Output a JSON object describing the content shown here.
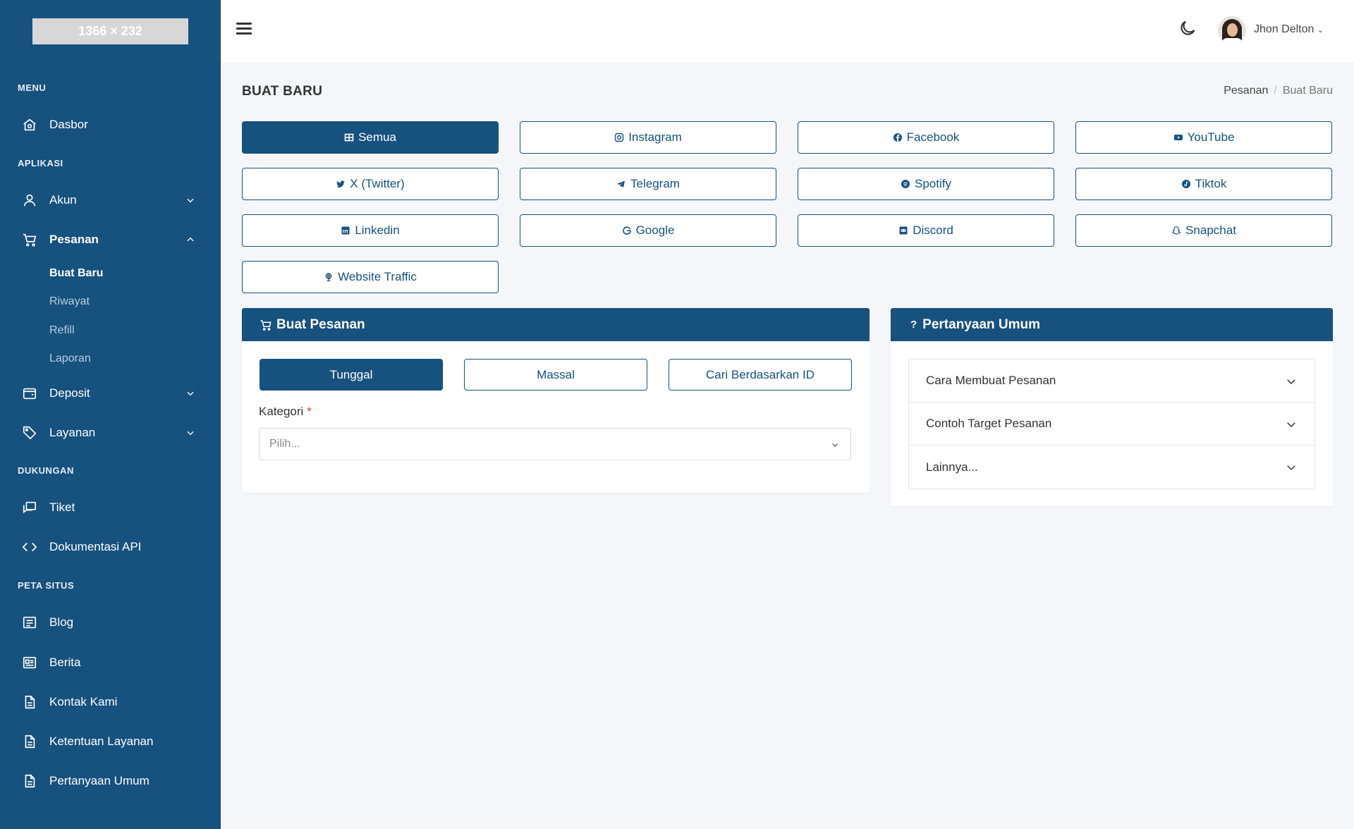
{
  "logo": {
    "text": "1366 × 232"
  },
  "sidebar": {
    "sections": {
      "menu": "MENU",
      "apps": "APLIKASI",
      "support": "DUKUNGAN",
      "sitemap": "PETA SITUS"
    },
    "items": {
      "dashboard": "Dasbor",
      "account": "Akun",
      "orders": "Pesanan",
      "deposit": "Deposit",
      "services": "Layanan",
      "ticket": "Tiket",
      "api_docs": "Dokumentasi API",
      "blog": "Blog",
      "news": "Berita",
      "contact": "Kontak Kami",
      "terms": "Ketentuan Layanan",
      "faq": "Pertanyaan Umum"
    },
    "orders_sub": {
      "new": "Buat Baru",
      "history": "Riwayat",
      "refill": "Refill",
      "report": "Laporan"
    }
  },
  "topbar": {
    "username": "Jhon Delton"
  },
  "page": {
    "title": "BUAT BARU",
    "breadcrumb": {
      "parent": "Pesanan",
      "current": "Buat Baru"
    }
  },
  "platforms": {
    "all": "Semua",
    "instagram": "Instagram",
    "facebook": "Facebook",
    "youtube": "YouTube",
    "twitter": "X (Twitter)",
    "telegram": "Telegram",
    "spotify": "Spotify",
    "tiktok": "Tiktok",
    "linkedin": "Linkedin",
    "google": "Google",
    "discord": "Discord",
    "snapchat": "Snapchat",
    "website": "Website Traffic"
  },
  "order_card": {
    "title": "Buat Pesanan",
    "tabs": {
      "single": "Tunggal",
      "mass": "Massal",
      "by_id": "Cari Berdasarkan ID"
    },
    "category_label": "Kategori",
    "required_mark": "*",
    "category_placeholder": "Pilih..."
  },
  "faq_card": {
    "title": "Pertanyaan Umum",
    "items": [
      "Cara Membuat Pesanan",
      "Contoh Target Pesanan",
      "Lainnya..."
    ]
  },
  "colors": {
    "primary": "#17517e",
    "background": "#f5f6fa",
    "required": "#e23b3b"
  }
}
